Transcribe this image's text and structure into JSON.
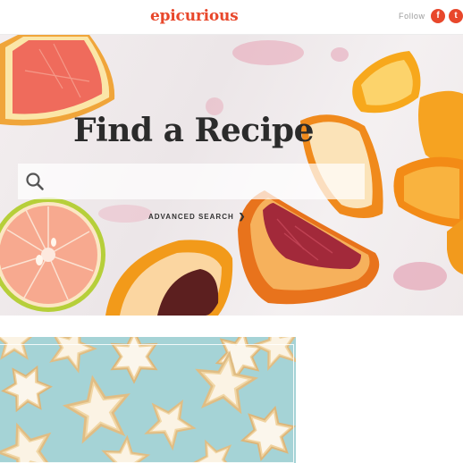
{
  "header": {
    "logo_text": "epicurious",
    "follow_label": "Follow",
    "social": [
      {
        "icon": "facebook-icon",
        "glyph": "f"
      },
      {
        "icon": "twitter-icon",
        "glyph": "t"
      }
    ]
  },
  "hero": {
    "title": "Find a Recipe",
    "search": {
      "placeholder": "",
      "value": ""
    },
    "advanced_search_label": "ADVANCED SEARCH"
  },
  "colors": {
    "brand": "#e8472b",
    "title": "#2b2b2b",
    "cookie_background": "#a5d3d6"
  }
}
